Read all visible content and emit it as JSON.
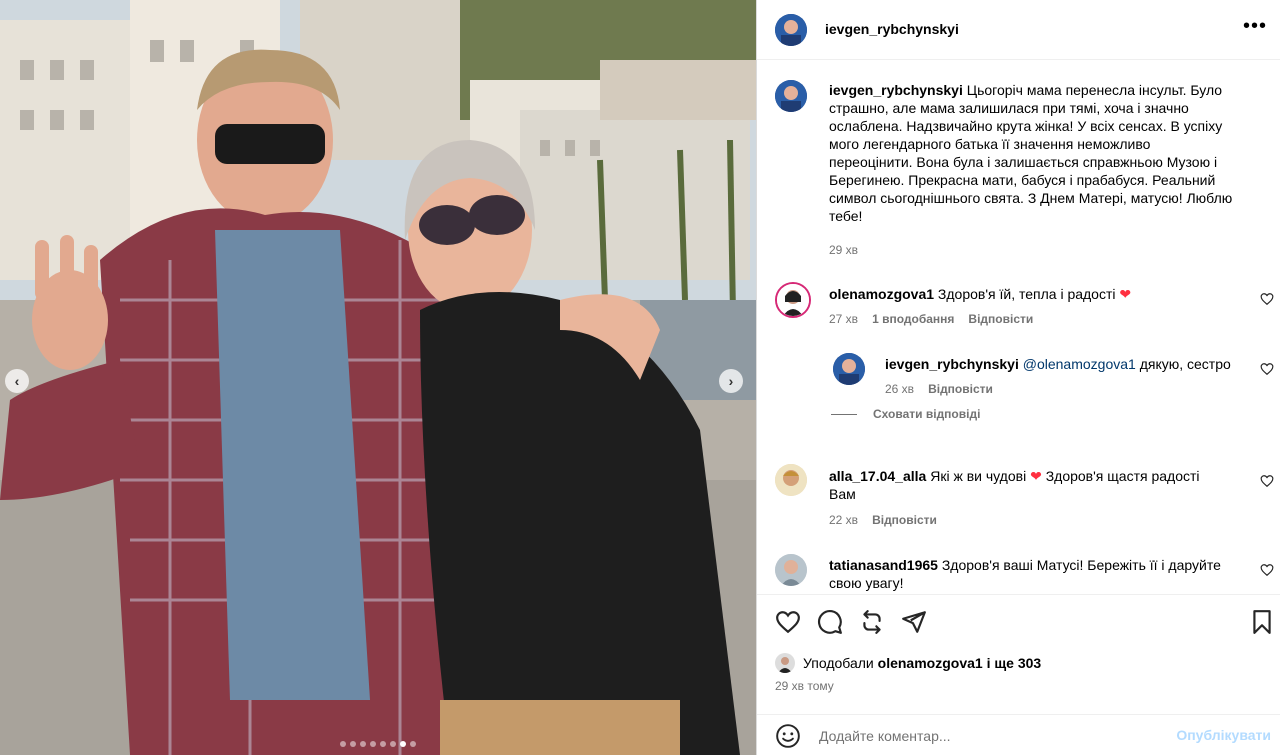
{
  "post": {
    "author": "ievgen_rybchynskyi",
    "caption": "Цьогоріч мама перенесла інсульт. Було страшно, але мама залишилася при тямі, хоча і значно ослаблена. Надзвичайно крута жінка! У всіх сенсах. В успіху мого легендарного батька її значення неможливо переоцінити. Вона була і залишається справжньою Музою і Берегинею. Прекрасна мати, бабуся і прабабуся. Реальний символ сьогоднішнього свята. З Днем Матері, матусю! Люблю тебе!",
    "caption_time": "29 хв",
    "image_dots": 8,
    "active_dot": 6
  },
  "comments": [
    {
      "user": "olenamozgova1",
      "text": "Здоров'я їй, тепла і радості",
      "time": "27 хв",
      "likes": "1 вподобання",
      "reply": "Відповісти"
    },
    {
      "user": "ievgen_rybchynskyi",
      "mention": "@olenamozgova1",
      "text": "дякую, сестро",
      "time": "26 хв",
      "reply": "Відповісти",
      "hide_replies": "Сховати відповіді"
    },
    {
      "user": "alla_17.04_alla",
      "text_a": "Які ж ви чудові",
      "text_b": "Здоров'я щастя радості Вам",
      "time": "22 хв",
      "reply": "Відповісти"
    },
    {
      "user": "tatianasand1965",
      "text": "Здоров'я ваші Матусі! Бережіть її і даруйте свою увагу!"
    }
  ],
  "footer": {
    "liked_prefix": "Уподобали",
    "liked_user": "olenamozgova1",
    "liked_suffix": "і ще 303",
    "time": "29 хв тому",
    "placeholder": "Додайте коментар...",
    "publish": "Опублікувати"
  },
  "icons": {
    "heart": "heart-icon",
    "comment": "comment-icon",
    "share": "share-icon",
    "repost": "repost-icon",
    "save": "bookmark-icon",
    "emoji": "emoji-icon",
    "more": "more-icon"
  },
  "colors": {
    "heart_red": "#ff3040",
    "link_blue": "#00376b",
    "publish_disabled": "#b3dbff"
  }
}
